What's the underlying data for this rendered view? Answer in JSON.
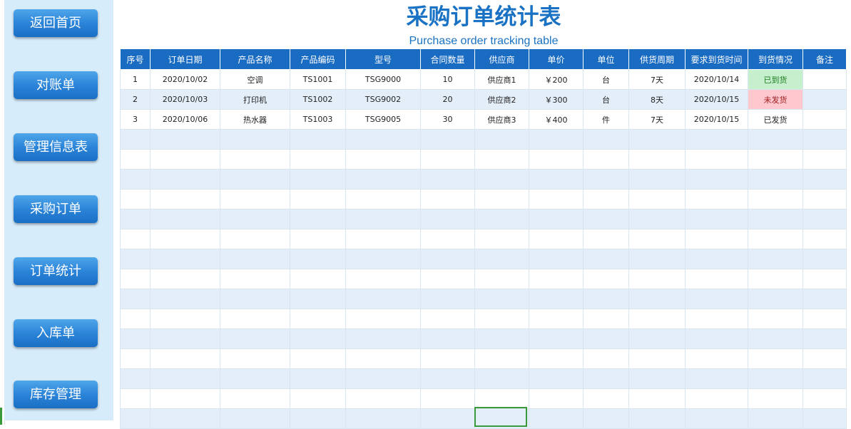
{
  "nav": [
    {
      "label": "返回首页"
    },
    {
      "label": "对账单"
    },
    {
      "label": "管理信息表"
    },
    {
      "label": "采购订单"
    },
    {
      "label": "订单统计"
    },
    {
      "label": "入库单"
    },
    {
      "label": "库存管理"
    }
  ],
  "header": {
    "title": "采购订单统计表",
    "subtitle": "Purchase order tracking table"
  },
  "table": {
    "columns": [
      "序号",
      "订单日期",
      "产品名称",
      "产品编码",
      "型号",
      "合同数量",
      "供应商",
      "单价",
      "单位",
      "供货周期",
      "要求到货时间",
      "到货情况",
      "备注"
    ],
    "rows": [
      [
        "1",
        "2020/10/02",
        "空调",
        "TS1001",
        "TSG9000",
        "10",
        "供应商1",
        "￥200",
        "台",
        "7天",
        "2020/10/14",
        "已到货",
        ""
      ],
      [
        "2",
        "2020/10/03",
        "打印机",
        "TS1002",
        "TSG9002",
        "20",
        "供应商2",
        "￥300",
        "台",
        "8天",
        "2020/10/15",
        "未发货",
        ""
      ],
      [
        "3",
        "2020/10/06",
        "热水器",
        "TS1003",
        "TSG9005",
        "30",
        "供应商3",
        "￥400",
        "件",
        "7天",
        "2020/10/15",
        "已发货",
        ""
      ]
    ],
    "empty_rows": 15
  },
  "colors": {
    "header_bg": "#1a6bc2",
    "title": "#1a72c4",
    "sidebar_bg": "#d6ecfb",
    "arrived_bg": "#c6efce",
    "not_sent_bg": "#ffc7ce"
  }
}
